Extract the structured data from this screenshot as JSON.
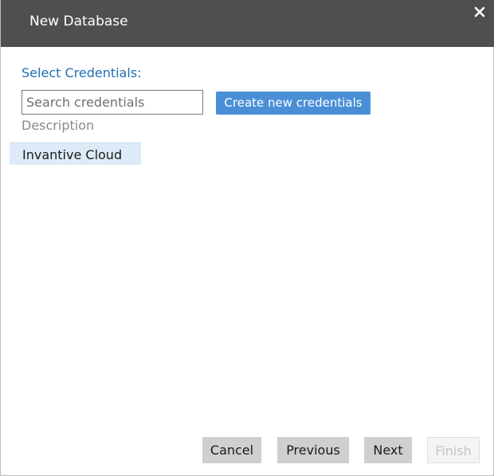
{
  "dialog": {
    "title": "New Database",
    "close_icon": "close-icon"
  },
  "credentials": {
    "section_label": "Select Credentials:",
    "search_placeholder": "Search credentials",
    "create_button_label": "Create new credentials",
    "column_header": "Description",
    "items": [
      {
        "label": "Invantive Cloud",
        "selected": true
      }
    ]
  },
  "footer": {
    "cancel_label": "Cancel",
    "previous_label": "Previous",
    "next_label": "Next",
    "finish_label": "Finish",
    "finish_disabled": true
  },
  "colors": {
    "titlebar": "#4f4f4f",
    "accent": "#4a8fd6",
    "label_blue": "#1f6fb5",
    "selected_row": "#dcebf7"
  }
}
